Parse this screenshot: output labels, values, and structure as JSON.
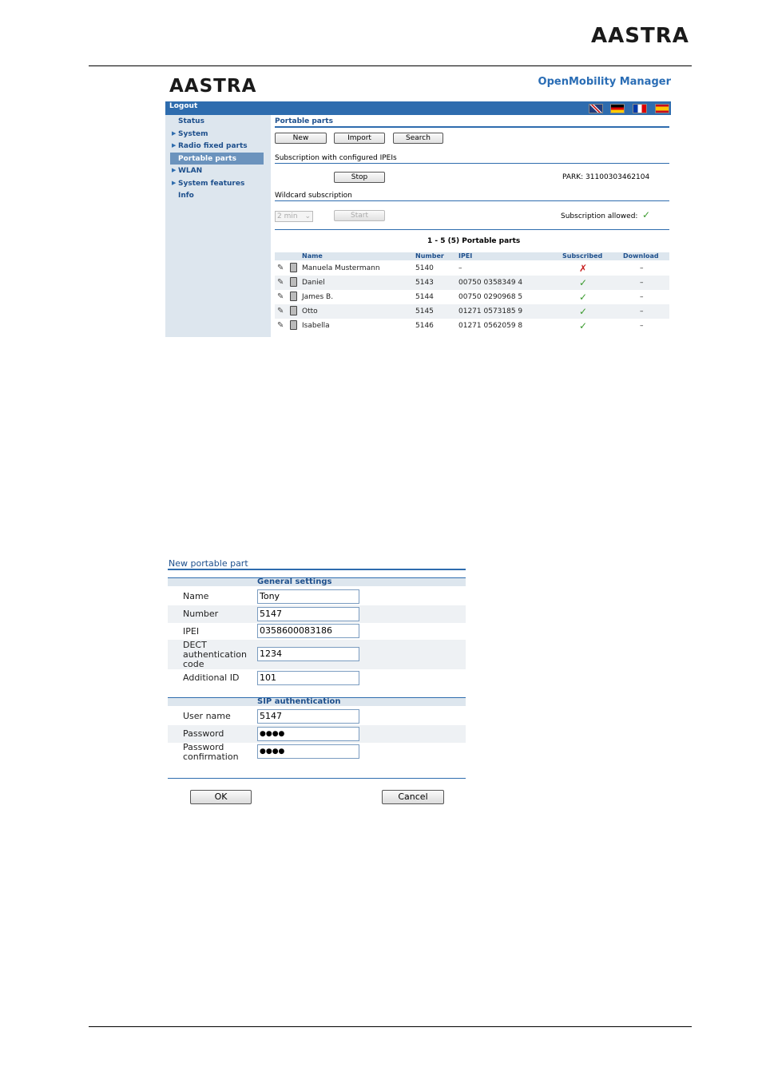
{
  "page": {
    "logo": "AASTRA"
  },
  "shot1": {
    "logo": "AASTRA",
    "app_title": "OpenMobility Manager",
    "logout": "Logout",
    "flags": [
      "uk-flag",
      "de-flag",
      "fr-flag",
      "es-flag"
    ],
    "nav": [
      {
        "label": "Status",
        "arrow": false,
        "active": false
      },
      {
        "label": "System",
        "arrow": true,
        "active": false
      },
      {
        "label": "Radio fixed parts",
        "arrow": true,
        "active": false
      },
      {
        "label": "Portable parts",
        "arrow": false,
        "active": true
      },
      {
        "label": "WLAN",
        "arrow": true,
        "active": false
      },
      {
        "label": "System features",
        "arrow": true,
        "active": false
      },
      {
        "label": "Info",
        "arrow": false,
        "active": false
      }
    ],
    "section_title": "Portable parts",
    "buttons": {
      "new": "New",
      "import": "Import",
      "search": "Search"
    },
    "subscription_title": "Subscription with configured IPEIs",
    "stop": "Stop",
    "park": "PARK: 31100303462104",
    "wildcard_title": "Wildcard subscription",
    "wildcard_select": "2 min",
    "start": "Start",
    "subscription_allowed": "Subscription allowed:",
    "table_caption": "1 - 5 (5) Portable parts",
    "columns": [
      "Name",
      "Number",
      "IPEI",
      "Subscribed",
      "Download"
    ],
    "rows": [
      {
        "name": "Manuela Mustermann",
        "number": "5140",
        "ipei": "–",
        "subscribed": "✗",
        "download": "–"
      },
      {
        "name": "Daniel",
        "number": "5143",
        "ipei": "00750 0358349 4",
        "subscribed": "✓",
        "download": "–"
      },
      {
        "name": "James B.",
        "number": "5144",
        "ipei": "00750 0290968 5",
        "subscribed": "✓",
        "download": "–"
      },
      {
        "name": "Otto",
        "number": "5145",
        "ipei": "01271 0573185 9",
        "subscribed": "✓",
        "download": "–"
      },
      {
        "name": "Isabella",
        "number": "5146",
        "ipei": "01271 0562059 8",
        "subscribed": "✓",
        "download": "–"
      }
    ]
  },
  "shot2": {
    "title": "New portable part",
    "general_header": "General settings",
    "general": [
      {
        "label": "Name",
        "value": "Tony"
      },
      {
        "label": "Number",
        "value": "5147"
      },
      {
        "label": "IPEI",
        "value": "0358600083186"
      },
      {
        "label": "DECT\nauthentication\ncode",
        "value": "1234"
      },
      {
        "label": "Additional ID",
        "value": "101"
      }
    ],
    "sip_header": "SIP authentication",
    "sip": [
      {
        "label": "User name",
        "value": "5147"
      },
      {
        "label": "Password",
        "value": "●●●●"
      },
      {
        "label": "Password\nconfirmation",
        "value": "●●●●"
      }
    ],
    "ok": "OK",
    "cancel": "Cancel"
  },
  "colors": {
    "accent": "#2e6cae",
    "sidebar": "#dde6ee",
    "ok_green": "#3a9a2e",
    "error_red": "#c82020"
  }
}
